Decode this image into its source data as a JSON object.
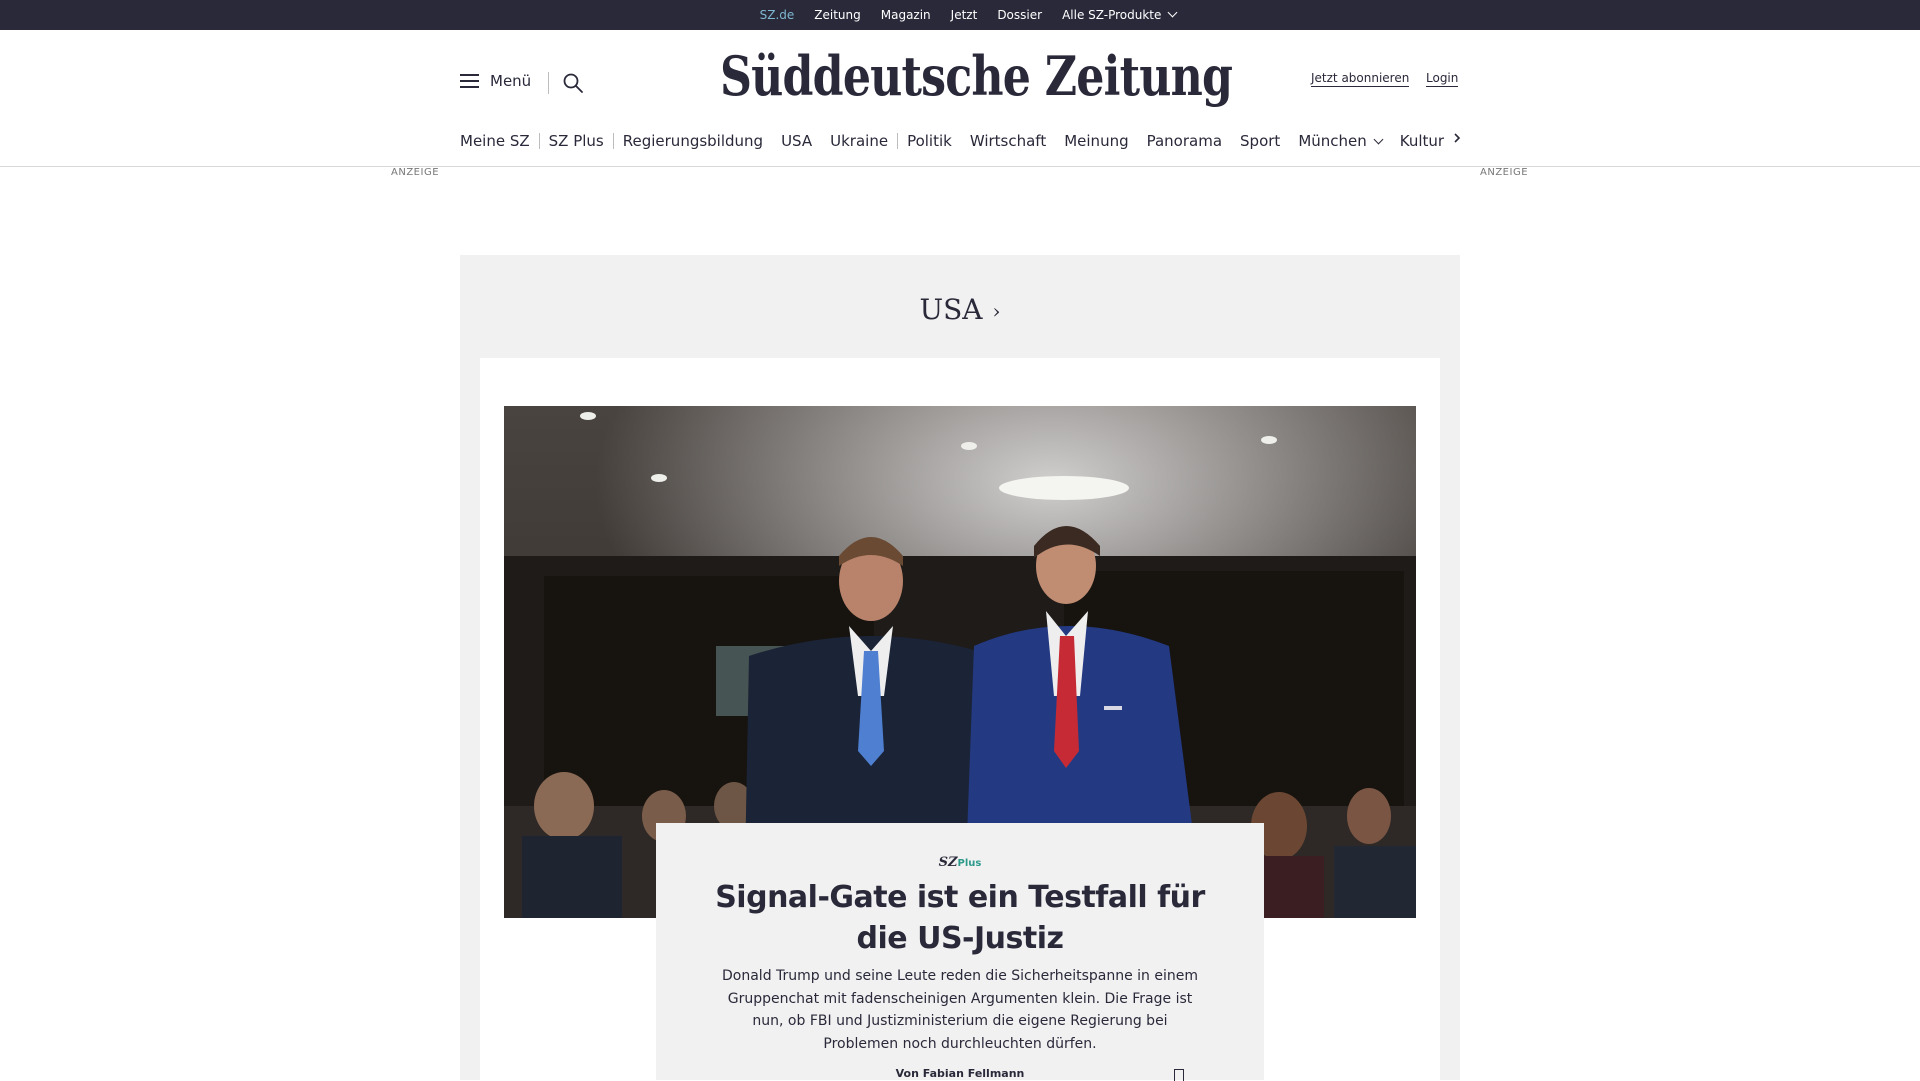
{
  "topbar": {
    "links": [
      "SZ.de",
      "Zeitung",
      "Magazin",
      "Jetzt",
      "Dossier",
      "Alle SZ-Produkte"
    ]
  },
  "header": {
    "menu_label": "Menü",
    "logo_text": "Süddeutsche Zeitung",
    "subscribe_label": "Jetzt abonnieren",
    "login_label": "Login"
  },
  "nav": {
    "items": [
      "Meine SZ",
      "SZ Plus",
      "Regierungsbildung",
      "USA",
      "Ukraine",
      "Politik",
      "Wirtschaft",
      "Meinung",
      "Panorama",
      "Sport",
      "München",
      "Kultur"
    ]
  },
  "ads": {
    "left_label": "ANZEIGE",
    "right_label": "ANZEIGE"
  },
  "section": {
    "title": "USA"
  },
  "teaser": {
    "badge_sz": "SZ",
    "badge_plus": "Plus",
    "headline": "Signal-Gate ist ein Testfall für die US-Justiz",
    "lead": "Donald Trump und seine Leute reden die Sicherheitspanne in einem Gruppenchat mit fadenscheinigen Argumenten klein. Die Frage ist nun, ob FBI und Justizministerium die eigene Regierung bei Problemen noch durchleuchten dürfen.",
    "author": "Von Fabian Fellmann"
  },
  "colors": {
    "brand_dark": "#29293a",
    "active_link": "#7fb6cf",
    "szplus_accent": "#2c9a8a",
    "section_bg": "#f1f1f1"
  }
}
